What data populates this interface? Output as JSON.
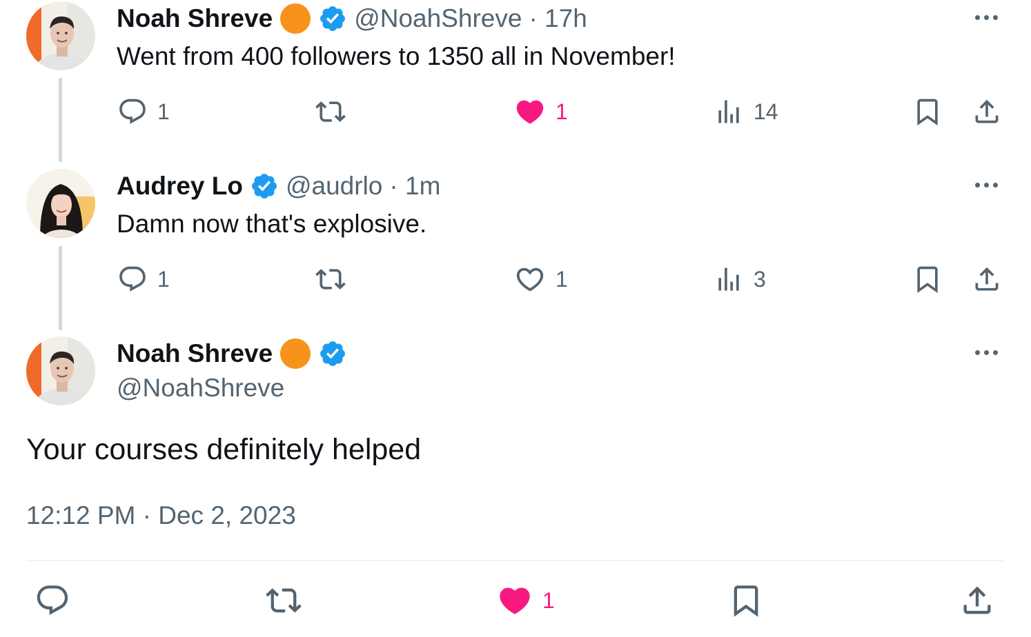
{
  "colors": {
    "accent_blue": "#1d9bf0",
    "like_pink": "#f91880",
    "muted": "#536471",
    "org_badge": "#f7931a"
  },
  "tweets": [
    {
      "name": "Noah Shreve",
      "handle": "@NoahShreve",
      "time": "· 17h",
      "text": "Went from 400 followers to 1350 all in November!",
      "replies": "1",
      "likes": "1",
      "views": "14",
      "liked": true
    },
    {
      "name": "Audrey Lo",
      "handle": "@audrlo",
      "time": "· 1m",
      "text": "Damn now that's explosive.",
      "replies": "1",
      "likes": "1",
      "views": "3",
      "liked": false
    }
  ],
  "main_tweet": {
    "name": "Noah Shreve",
    "handle": "@NoahShreve",
    "text": "Your courses definitely helped",
    "timestamp": "12:12 PM · Dec 2, 2023",
    "likes": "1"
  },
  "icons": [
    "reply-icon",
    "retweet-icon",
    "like-icon",
    "views-icon",
    "bookmark-icon",
    "share-icon",
    "more-icon",
    "verified-icon",
    "org-badge-icon"
  ]
}
